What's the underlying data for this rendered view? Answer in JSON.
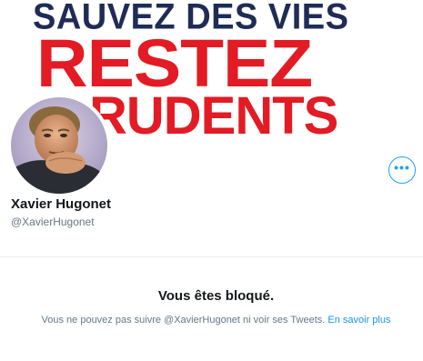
{
  "banner": {
    "line1": "SAUVEZ DES VIES",
    "line2": "RESTEZ",
    "line3": "RUDENTS",
    "colors": {
      "navy": "#1f2c55",
      "red": "#e21b24"
    }
  },
  "profile": {
    "display_name": "Xavier Hugonet",
    "handle": "@XavierHugonet",
    "avatar_icon": "profile-photo"
  },
  "actions": {
    "more_label": "•••",
    "more_icon": "more-horizontal-icon"
  },
  "blocked": {
    "title": "Vous êtes bloqué.",
    "description": "Vous ne pouvez pas suivre @XavierHugonet ni voir ses Tweets.",
    "learn_more": "En savoir plus"
  },
  "colors": {
    "accent": "#1da1f2",
    "link": "#1b95e0",
    "text_primary": "#14171a",
    "text_secondary": "#657786",
    "divider": "#e6ecf0"
  }
}
